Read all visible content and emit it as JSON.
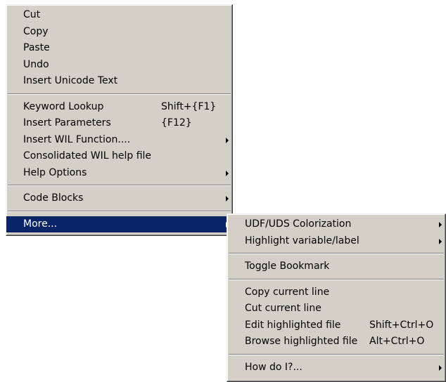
{
  "context_menu": {
    "groups": [
      {
        "items": [
          {
            "label": "Cut"
          },
          {
            "label": "Copy"
          },
          {
            "label": "Paste"
          },
          {
            "label": "Undo"
          },
          {
            "label": "Insert Unicode Text"
          }
        ]
      },
      {
        "items": [
          {
            "label": "Keyword Lookup",
            "shortcut": "Shift+{F1}"
          },
          {
            "label": "Insert Parameters",
            "shortcut": "{F12}"
          },
          {
            "label": "Insert WIL Function....",
            "submenu_icon": "chevron-right-icon"
          },
          {
            "label": "Consolidated WIL help file"
          },
          {
            "label": "Help Options",
            "submenu_icon": "chevron-right-icon"
          }
        ]
      },
      {
        "items": [
          {
            "label": "Code Blocks",
            "submenu_icon": "chevron-right-icon"
          }
        ]
      },
      {
        "items": [
          {
            "label": "More...",
            "submenu_icon": "chevron-right-icon",
            "selected": true
          }
        ]
      }
    ]
  },
  "submenu": {
    "groups": [
      {
        "items": [
          {
            "label": "UDF/UDS Colorization",
            "submenu_icon": "chevron-right-icon"
          },
          {
            "label": "Highlight variable/label",
            "submenu_icon": "chevron-right-icon"
          }
        ]
      },
      {
        "items": [
          {
            "label": "Toggle Bookmark"
          }
        ]
      },
      {
        "items": [
          {
            "label": "Copy current line"
          },
          {
            "label": "Cut current line"
          },
          {
            "label": "Edit highlighted file",
            "shortcut": "Shift+Ctrl+O"
          },
          {
            "label": "Browse highlighted file",
            "shortcut": "Alt+Ctrl+O"
          }
        ]
      },
      {
        "items": [
          {
            "label": "How do I?...",
            "submenu_icon": "chevron-right-icon"
          }
        ]
      }
    ]
  },
  "colors": {
    "menu_background": "#d4d0c8",
    "selection_background": "#0a246a",
    "selection_text": "#ffffff"
  }
}
